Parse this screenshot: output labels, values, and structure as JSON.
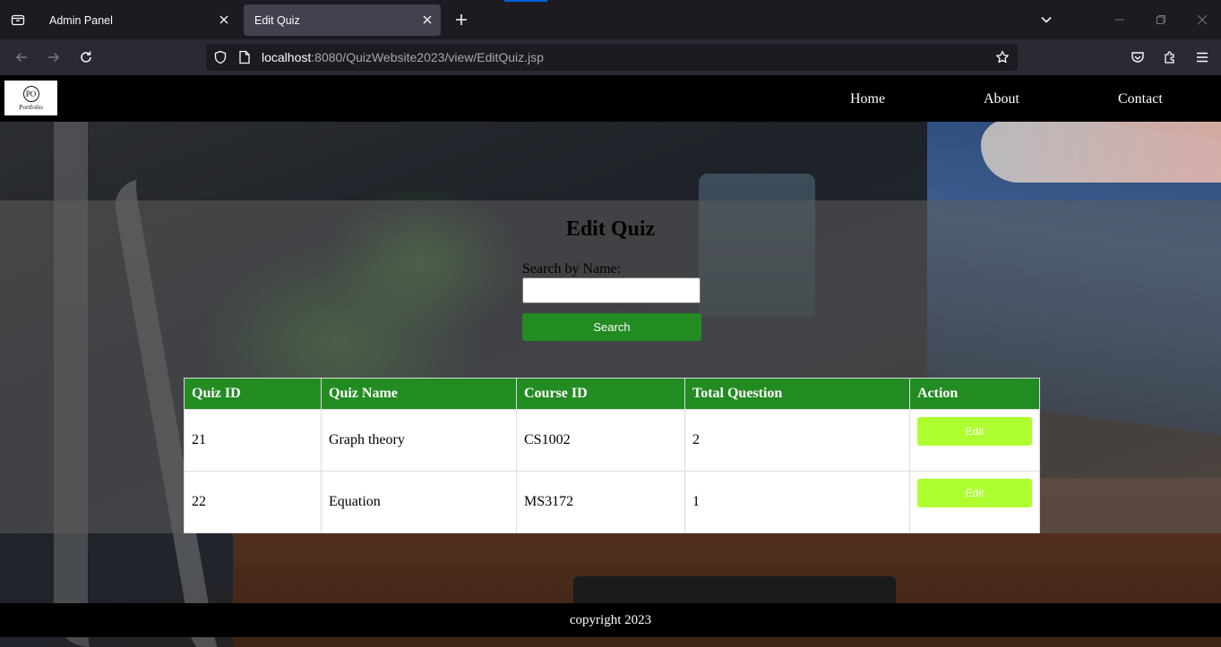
{
  "browser": {
    "tabs": [
      {
        "label": "Admin Panel",
        "active": false
      },
      {
        "label": "Edit Quiz",
        "active": true
      }
    ],
    "url": {
      "host": "localhost",
      "rest": ":8080/QuizWebsite2023/view/EditQuiz.jsp"
    }
  },
  "site": {
    "logo": {
      "monogram": "PO",
      "text": "Portfolio"
    },
    "nav": {
      "home": "Home",
      "about": "About",
      "contact": "Contact"
    }
  },
  "main": {
    "title": "Edit Quiz",
    "search": {
      "label": "Search by Name:",
      "value": "",
      "button": "Search"
    },
    "table": {
      "headers": {
        "id": "Quiz ID",
        "name": "Quiz Name",
        "course": "Course ID",
        "total": "Total Question",
        "action": "Action"
      },
      "rows": [
        {
          "id": "21",
          "name": "Graph theory",
          "course": "CS1002",
          "total": "2",
          "action": "Edit"
        },
        {
          "id": "22",
          "name": "Equation",
          "course": "MS3172",
          "total": "1",
          "action": "Edit"
        }
      ]
    }
  },
  "footer": {
    "text": "copyright 2023"
  },
  "colors": {
    "header_green": "#228b22",
    "edit_button": "#adff2f",
    "browser_bg": "#1c1b22"
  }
}
